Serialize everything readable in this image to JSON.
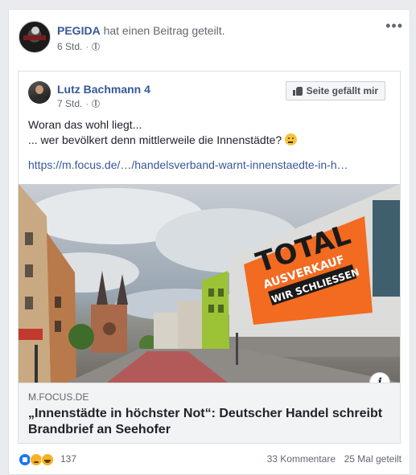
{
  "post": {
    "page_name": "PEGIDA",
    "action_text": "hat einen Beitrag geteilt.",
    "time": "6 Std.",
    "privacy_icon": "globe-icon",
    "more_icon": "more-options-icon",
    "more_label": "•••"
  },
  "shared": {
    "author": "Lutz Bachmann 4",
    "time": "7 Std.",
    "like_page_label": "Seite gefällt mir",
    "text_line1": "Woran das wohl liegt...",
    "text_line2": "... wer bevölkert denn mittlerweile die Innenstädte?",
    "link": "https://m.focus.de/…/handelsverband-warnt-innenstaedte-in-h…"
  },
  "link_preview": {
    "domain": "M.FOCUS.DE",
    "headline": "„Innenstädte in höchster Not“: Deutscher Handel schreibt Brandbrief an Seehofer",
    "info_label": "i",
    "banner_line1": "TOTAL",
    "banner_line2": "AUSVERKAUF",
    "banner_line3": "WIR SCHLIESSEN"
  },
  "footer": {
    "reaction_icons": [
      "like-icon",
      "sad-icon",
      "haha-icon"
    ],
    "reaction_count": "137",
    "comments": "33 Kommentare",
    "shares": "25 Mal geteilt"
  },
  "colors": {
    "link_blue": "#385898",
    "banner_orange": "#f26b21"
  }
}
